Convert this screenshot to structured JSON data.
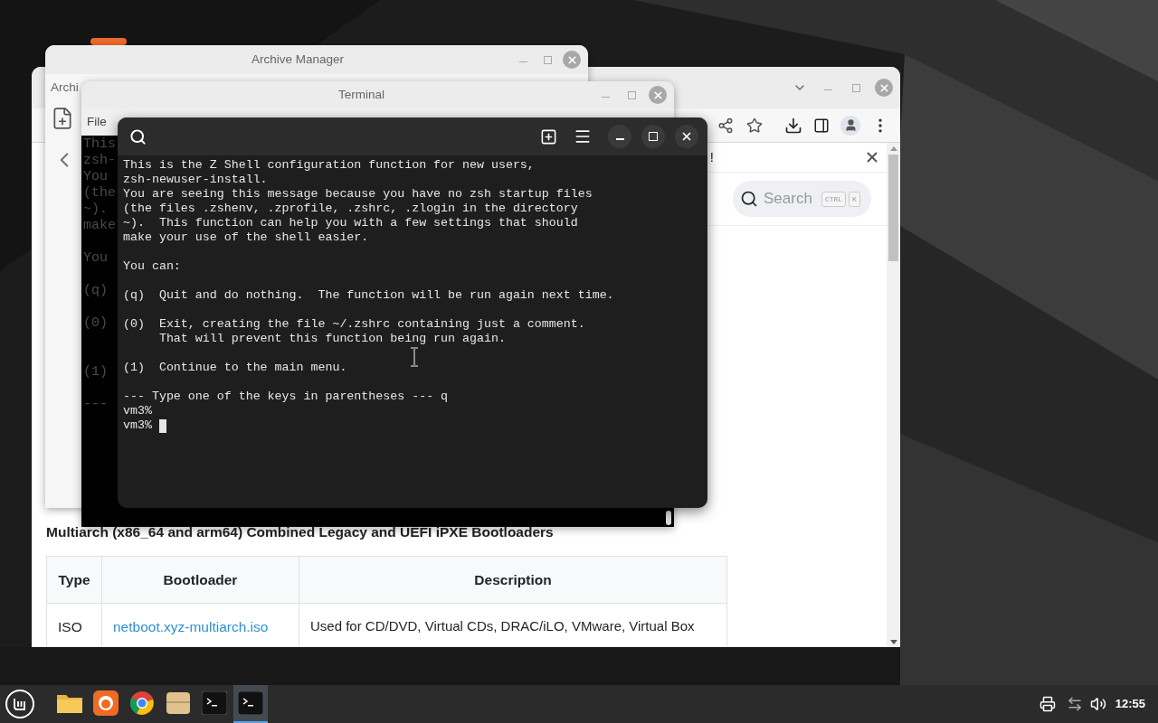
{
  "archive_manager": {
    "title": "Archive Manager",
    "tab": "Archi"
  },
  "browser": {
    "notice_end": "!",
    "search": {
      "placeholder": "Search",
      "keys": [
        "CTRL",
        "K"
      ]
    },
    "heading": "Multiarch (x86_64 and arm64) Combined Legacy and UEFI iPXE Bootloaders",
    "table": {
      "columns": [
        "Type",
        "Bootloader",
        "Description"
      ],
      "rows": [
        {
          "type": "ISO",
          "bootloader": "netboot.xyz-multiarch.iso",
          "description": "Used for CD/DVD, Virtual CDs, DRAC/iLO, VMware, Virtual Box"
        }
      ]
    }
  },
  "terminal_back": {
    "title": "Terminal",
    "menu": [
      "File"
    ],
    "lines": [
      {
        "kind": "text",
        "text": "This"
      },
      {
        "kind": "text",
        "text": "zsh-"
      },
      {
        "kind": "text",
        "text": "You"
      },
      {
        "kind": "text",
        "text": "(the"
      },
      {
        "kind": "text",
        "text": "~)."
      },
      {
        "kind": "text",
        "text": "make"
      },
      {
        "kind": "blank"
      },
      {
        "kind": "text",
        "text": "You"
      },
      {
        "kind": "blank"
      },
      {
        "kind": "text",
        "text": "(q)"
      },
      {
        "kind": "blank"
      },
      {
        "kind": "text",
        "text": "(0)"
      },
      {
        "kind": "blank"
      },
      {
        "kind": "blank"
      },
      {
        "kind": "text",
        "text": "(1)"
      },
      {
        "kind": "blank"
      },
      {
        "kind": "text",
        "text": "---"
      }
    ]
  },
  "terminal": {
    "lines": [
      {
        "kind": "text",
        "text": "This is the Z Shell configuration function for new users,"
      },
      {
        "kind": "text",
        "text": "zsh-newuser-install."
      },
      {
        "kind": "text",
        "text": "You are seeing this message because you have no zsh startup files"
      },
      {
        "kind": "text",
        "text": "(the files .zshenv, .zprofile, .zshrc, .zlogin in the directory"
      },
      {
        "kind": "text",
        "text": "~).  This function can help you with a few settings that should"
      },
      {
        "kind": "text",
        "text": "make your use of the shell easier."
      },
      {
        "kind": "blank"
      },
      {
        "kind": "text",
        "text": "You can:"
      },
      {
        "kind": "blank"
      },
      {
        "kind": "text",
        "text": "(q)  Quit and do nothing.  The function will be run again next time."
      },
      {
        "kind": "blank"
      },
      {
        "kind": "text",
        "text": "(0)  Exit, creating the file ~/.zshrc containing just a comment."
      },
      {
        "kind": "text",
        "text": "     That will prevent this function being run again."
      },
      {
        "kind": "blank"
      },
      {
        "kind": "text",
        "text": "(1)  Continue to the main menu."
      },
      {
        "kind": "blank"
      },
      {
        "kind": "text",
        "text": "--- Type one of the keys in parentheses --- q"
      },
      {
        "kind": "text",
        "text": "vm3%"
      },
      {
        "kind": "prompt",
        "text": "vm3%",
        "cursor": true
      }
    ]
  },
  "taskbar": {
    "apps": [
      {
        "kind": "folder",
        "selected": false
      },
      {
        "kind": "fox",
        "selected": false
      },
      {
        "kind": "globe",
        "selected": false
      },
      {
        "kind": "archive",
        "selected": false
      },
      {
        "kind": "terminal",
        "selected": false
      },
      {
        "kind": "terminal",
        "selected": true
      }
    ],
    "clock": "12:55"
  }
}
